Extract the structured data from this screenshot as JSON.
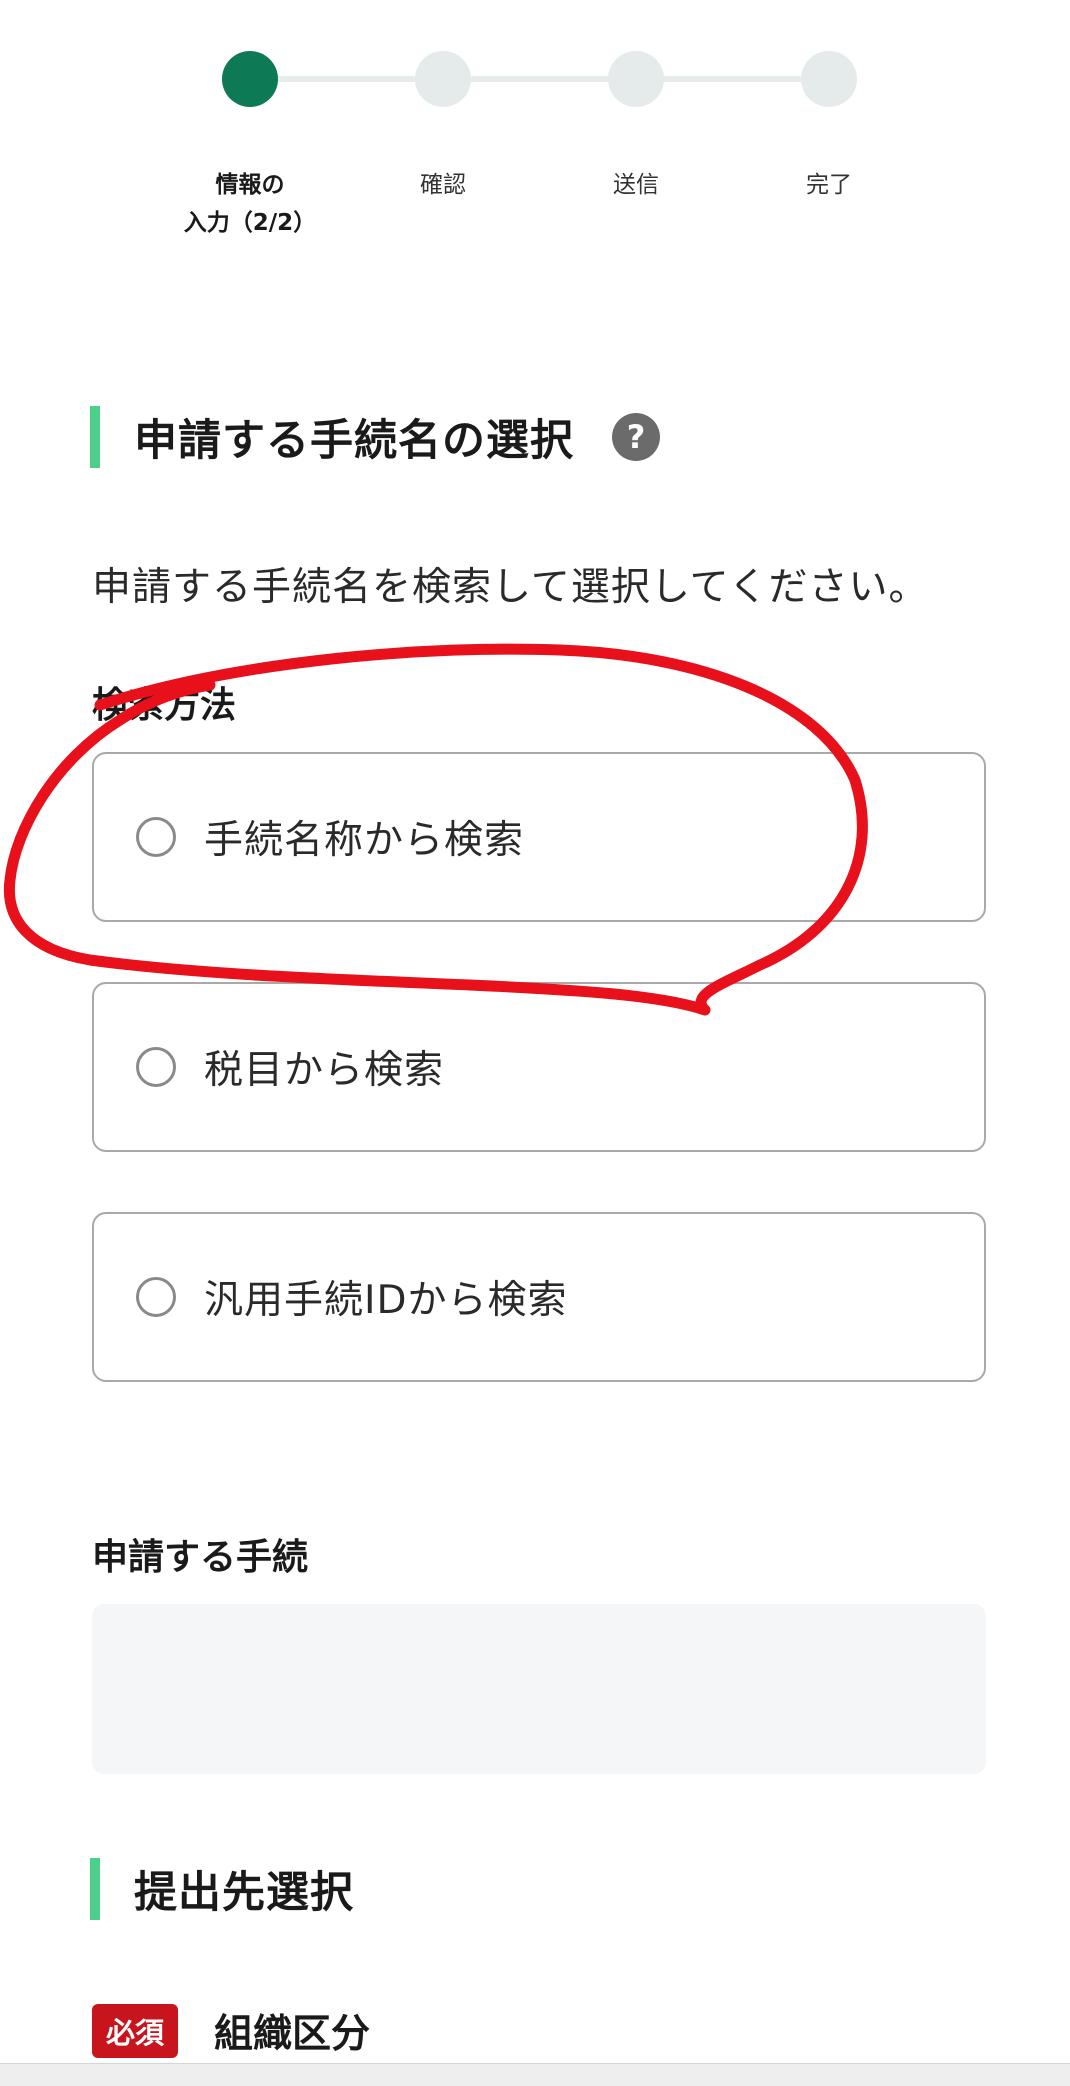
{
  "stepper": {
    "steps": [
      {
        "label_line1": "情報の",
        "label_line2": "入力（2/2）",
        "state": "active"
      },
      {
        "label_line1": "確認",
        "label_line2": "",
        "state": "pending"
      },
      {
        "label_line1": "送信",
        "label_line2": "",
        "state": "pending"
      },
      {
        "label_line1": "完了",
        "label_line2": "",
        "state": "pending"
      }
    ],
    "active_color": "#0e7a55",
    "inactive_color": "#e4ebea"
  },
  "procedure_section": {
    "title": "申請する手続名の選択",
    "help_icon": "question-mark-icon",
    "help_glyph": "?",
    "instruction": "申請する手続名を検索して選択してください。",
    "search_method_label": "検索方法",
    "options": [
      {
        "label": "手続名称から検索",
        "selected": false
      },
      {
        "label": "税目から検索",
        "selected": false
      },
      {
        "label": "汎用手続IDから検索",
        "selected": false
      }
    ],
    "selected_procedure_label": "申請する手続",
    "selected_procedure_value": ""
  },
  "destination_section": {
    "title": "提出先選択",
    "required_badge": "必須",
    "org_category_label": "組織区分"
  },
  "colors": {
    "heading_accent": "#4ccf8a",
    "required_badge": "#c8141c",
    "annotation": "#e8101a"
  }
}
